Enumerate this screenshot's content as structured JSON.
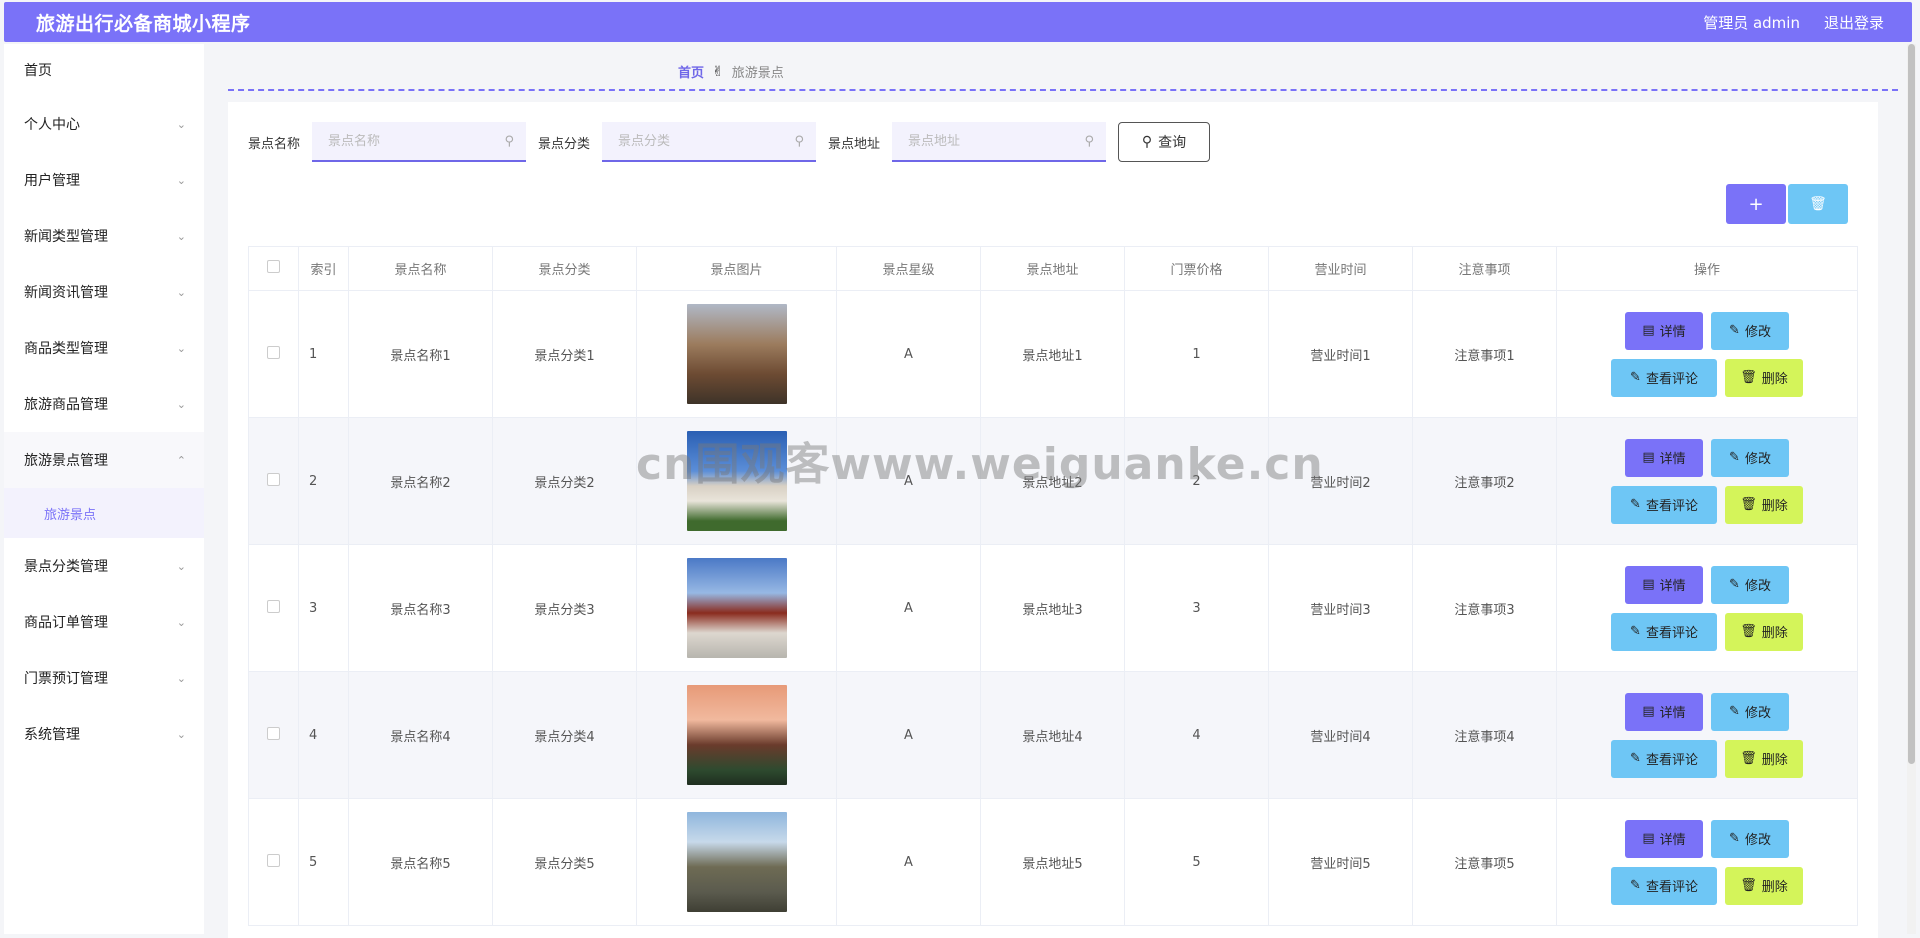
{
  "header": {
    "title": "旅游出行必备商城小程序",
    "user": "管理员 admin",
    "logout": "退出登录"
  },
  "sidebar": {
    "home": "首页",
    "items": [
      {
        "label": "个人中心"
      },
      {
        "label": "用户管理"
      },
      {
        "label": "新闻类型管理"
      },
      {
        "label": "新闻资讯管理"
      },
      {
        "label": "商品类型管理"
      },
      {
        "label": "旅游商品管理"
      },
      {
        "label": "旅游景点管理"
      },
      {
        "label": "景点分类管理"
      },
      {
        "label": "商品订单管理"
      },
      {
        "label": "门票预订管理"
      },
      {
        "label": "系统管理"
      }
    ],
    "submenu": "旅游景点"
  },
  "breadcrumb": {
    "home": "首页",
    "current": "旅游景点"
  },
  "search": {
    "name_label": "景点名称",
    "name_placeholder": "景点名称",
    "category_label": "景点分类",
    "category_placeholder": "景点分类",
    "address_label": "景点地址",
    "address_placeholder": "景点地址",
    "query": "查询"
  },
  "table": {
    "headers": [
      "索引",
      "景点名称",
      "景点分类",
      "景点图片",
      "景点星级",
      "景点地址",
      "门票价格",
      "营业时间",
      "注意事项",
      "操作"
    ],
    "rows": [
      {
        "index": "1",
        "name": "景点名称1",
        "category": "景点分类1",
        "star": "A",
        "address": "景点地址1",
        "price": "1",
        "hours": "营业时间1",
        "notes": "注意事项1"
      },
      {
        "index": "2",
        "name": "景点名称2",
        "category": "景点分类2",
        "star": "A",
        "address": "景点地址2",
        "price": "2",
        "hours": "营业时间2",
        "notes": "注意事项2"
      },
      {
        "index": "3",
        "name": "景点名称3",
        "category": "景点分类3",
        "star": "A",
        "address": "景点地址3",
        "price": "3",
        "hours": "营业时间3",
        "notes": "注意事项3"
      },
      {
        "index": "4",
        "name": "景点名称4",
        "category": "景点分类4",
        "star": "A",
        "address": "景点地址4",
        "price": "4",
        "hours": "营业时间4",
        "notes": "注意事项4"
      },
      {
        "index": "5",
        "name": "景点名称5",
        "category": "景点分类5",
        "star": "A",
        "address": "景点地址5",
        "price": "5",
        "hours": "营业时间5",
        "notes": "注意事项5"
      }
    ],
    "ops": {
      "detail": "详情",
      "edit": "修改",
      "review": "查看评论",
      "delete": "删除"
    }
  },
  "watermark": "cn围观客www.weiguanke.cn",
  "colors": {
    "accent": "#7a72f8",
    "info": "#6ec6f5",
    "lime": "#d4f45a"
  }
}
